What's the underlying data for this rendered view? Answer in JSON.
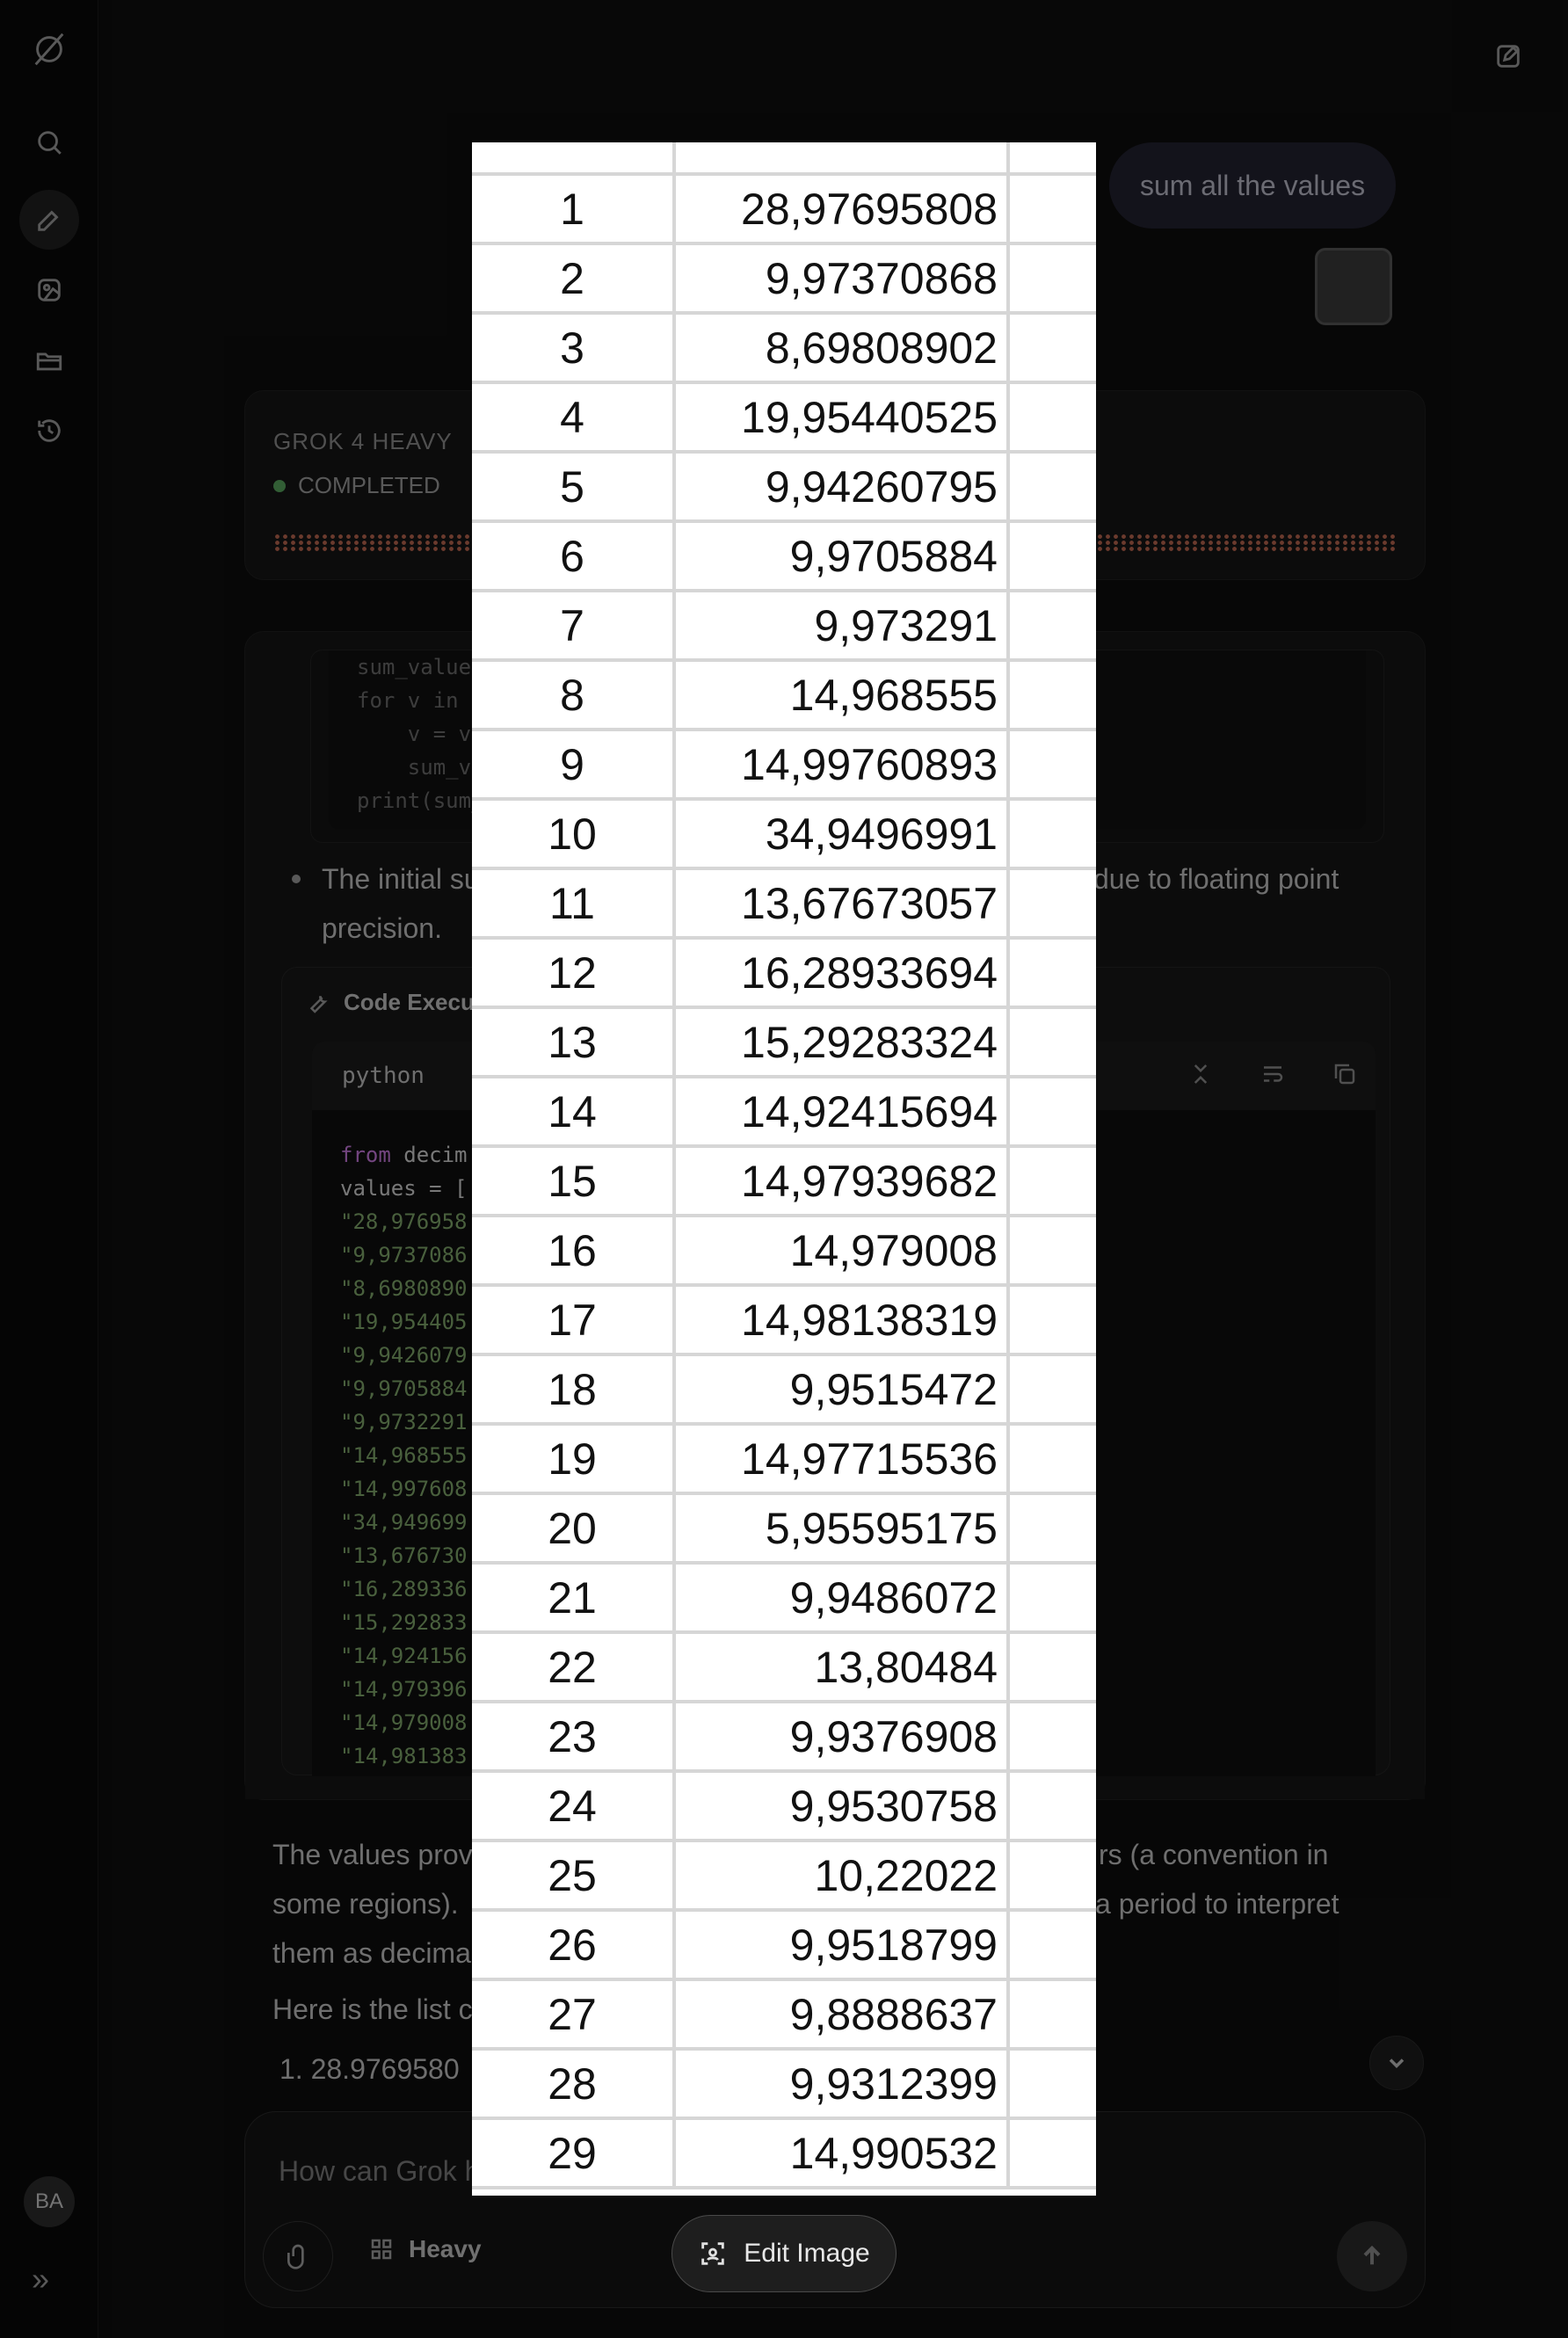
{
  "sidebar": {
    "avatar_initials": "BA"
  },
  "chat": {
    "user_message": "sum all the values",
    "heavy_card": {
      "title": "GROK 4 HEAVY",
      "status": "COMPLETED"
    },
    "code_top_lines": [
      "sum_value",
      "for v in v",
      "    v = v.",
      "    sum_va",
      "print(sum_"
    ],
    "bullet_text_left": "The initial su",
    "bullet_text_right": "due to floating point",
    "bullet_text_line2": "precision.",
    "exec_title": "Code Execu",
    "code_lang": "python",
    "code_lines": [
      {
        "kw": "from",
        "rest": " decim"
      },
      {
        "kw": "",
        "rest": "values = ["
      },
      {
        "kw": "",
        "str": "\"28,976958"
      },
      {
        "kw": "",
        "str": "\"9,9737086"
      },
      {
        "kw": "",
        "str": "\"8,6980890"
      },
      {
        "kw": "",
        "str": "\"19,954405"
      },
      {
        "kw": "",
        "str": "\"9,9426079"
      },
      {
        "kw": "",
        "str": "\"9,9705884"
      },
      {
        "kw": "",
        "str": "\"9,9732291"
      },
      {
        "kw": "",
        "str": "\"14,968555"
      },
      {
        "kw": "",
        "str": "\"14,997608"
      },
      {
        "kw": "",
        "str": "\"34,949699"
      },
      {
        "kw": "",
        "str": "\"13,676730"
      },
      {
        "kw": "",
        "str": "\"16,289336"
      },
      {
        "kw": "",
        "str": "\"15,292833"
      },
      {
        "kw": "",
        "str": "\"14,924156"
      },
      {
        "kw": "",
        "str": "\"14,979396"
      },
      {
        "kw": "",
        "str": "\"14,979008"
      },
      {
        "kw": "",
        "str": "\"14,981383"
      }
    ],
    "para1_line1_left": "The values prov",
    "para1_line1_right": "rs (a convention in",
    "para1_line2_left": "some regions).",
    "para1_line2_right": "a period to interpret",
    "para1_line3_left": "them as decima",
    "para2_left": "Here is the list c",
    "list_item_1": "28.9769580"
  },
  "composer": {
    "placeholder": "How can Grok help?",
    "model_label": "Heavy"
  },
  "image_modal": {
    "rows": [
      {
        "idx": "1",
        "value": "28,97695808"
      },
      {
        "idx": "2",
        "value": "9,97370868"
      },
      {
        "idx": "3",
        "value": "8,69808902"
      },
      {
        "idx": "4",
        "value": "19,95440525"
      },
      {
        "idx": "5",
        "value": "9,94260795"
      },
      {
        "idx": "6",
        "value": "9,9705884"
      },
      {
        "idx": "7",
        "value": "9,973291"
      },
      {
        "idx": "8",
        "value": "14,968555"
      },
      {
        "idx": "9",
        "value": "14,99760893"
      },
      {
        "idx": "10",
        "value": "34,9496991"
      },
      {
        "idx": "11",
        "value": "13,67673057"
      },
      {
        "idx": "12",
        "value": "16,28933694"
      },
      {
        "idx": "13",
        "value": "15,29283324"
      },
      {
        "idx": "14",
        "value": "14,92415694"
      },
      {
        "idx": "15",
        "value": "14,97939682"
      },
      {
        "idx": "16",
        "value": "14,979008"
      },
      {
        "idx": "17",
        "value": "14,98138319"
      },
      {
        "idx": "18",
        "value": "9,9515472"
      },
      {
        "idx": "19",
        "value": "14,97715536"
      },
      {
        "idx": "20",
        "value": "5,95595175"
      },
      {
        "idx": "21",
        "value": "9,9486072"
      },
      {
        "idx": "22",
        "value": "13,80484"
      },
      {
        "idx": "23",
        "value": "9,9376908"
      },
      {
        "idx": "24",
        "value": "9,9530758"
      },
      {
        "idx": "25",
        "value": "10,22022"
      },
      {
        "idx": "26",
        "value": "9,9518799"
      },
      {
        "idx": "27",
        "value": "9,8888637"
      },
      {
        "idx": "28",
        "value": "9,9312399"
      },
      {
        "idx": "29",
        "value": "14,990532"
      }
    ],
    "edit_button_label": "Edit Image"
  }
}
